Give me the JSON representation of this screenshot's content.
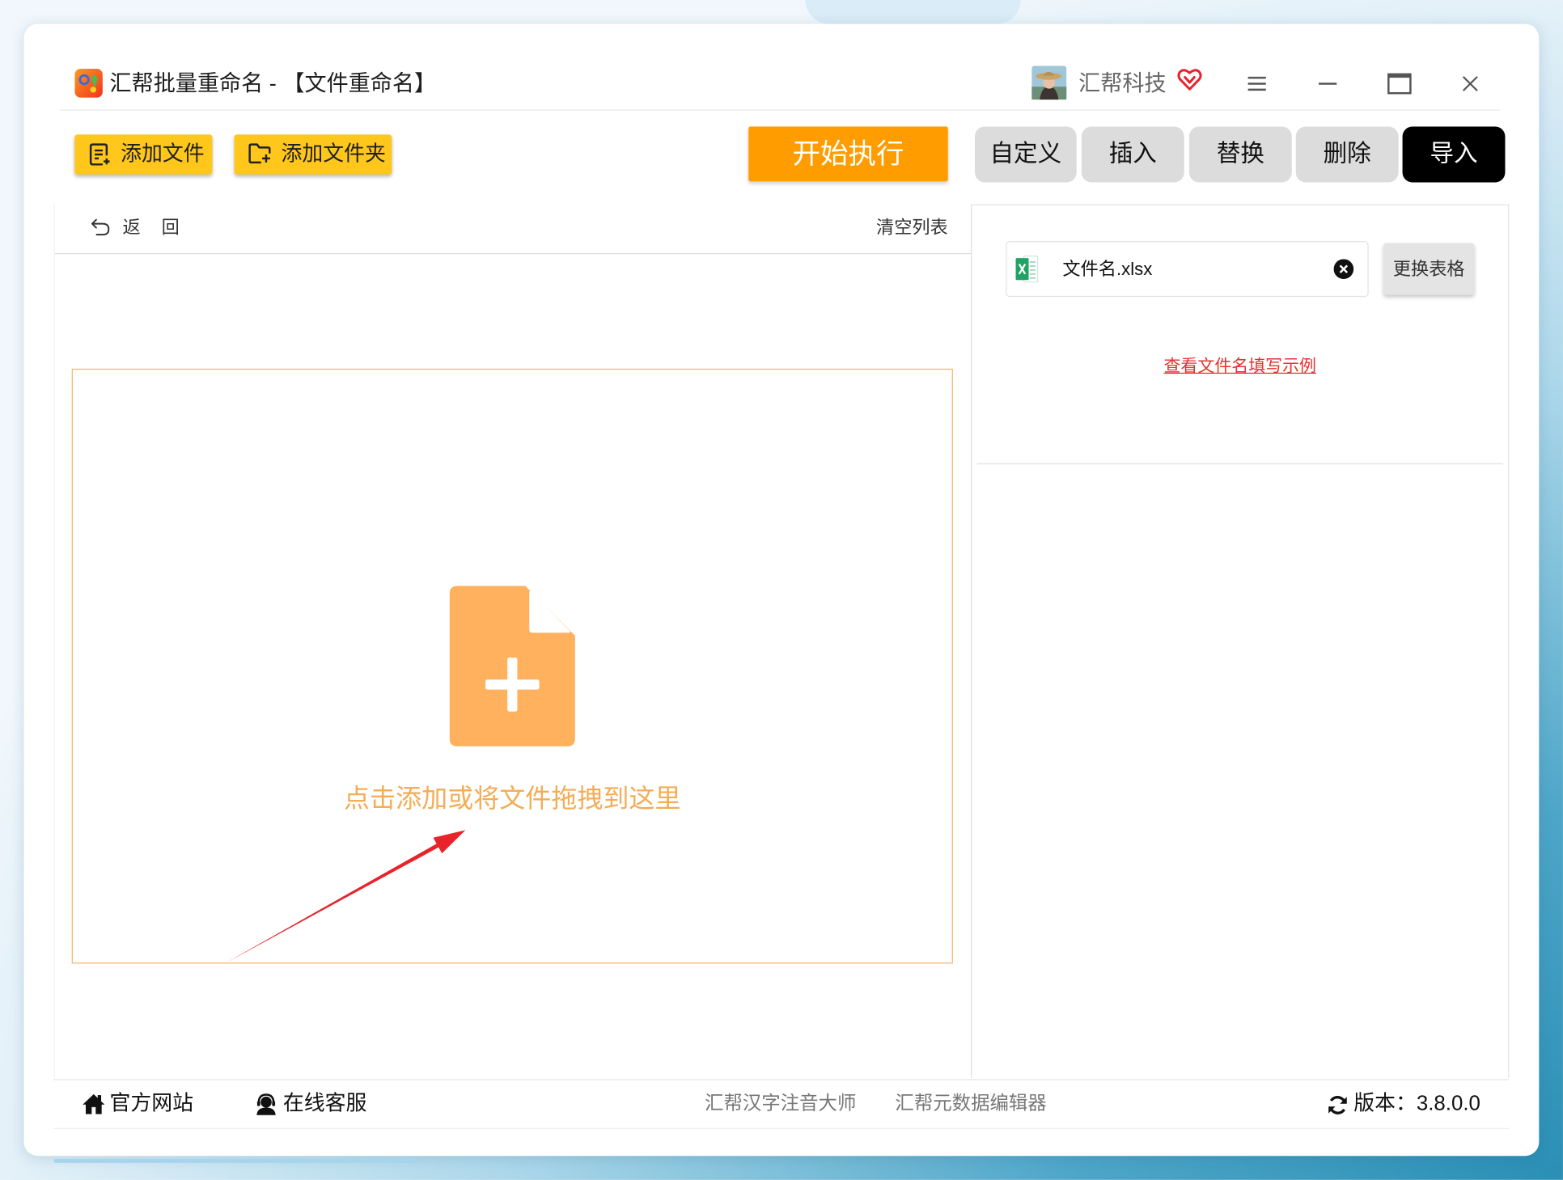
{
  "window": {
    "title": "汇帮批量重命名 - 【文件重命名】",
    "user_name": "汇帮科技"
  },
  "toolbar": {
    "add_file_label": "添加文件",
    "add_folder_label": "添加文件夹",
    "start_label": "开始执行",
    "tabs": [
      {
        "label": "自定义",
        "active": false
      },
      {
        "label": "插入",
        "active": false
      },
      {
        "label": "替换",
        "active": false
      },
      {
        "label": "删除",
        "active": false
      },
      {
        "label": "导入",
        "active": true
      }
    ]
  },
  "file_list": {
    "back_label": "返 回",
    "clear_label": "清空列表",
    "drop_hint": "点击添加或将文件拖拽到这里"
  },
  "import_panel": {
    "file_name": "文件名.xlsx",
    "replace_label": "更换表格",
    "example_link": "查看文件名填写示例"
  },
  "footer": {
    "website_label": "官方网站",
    "support_label": "在线客服",
    "links": [
      "汇帮汉字注音大师",
      "汇帮元数据编辑器"
    ],
    "version_label": "版本：",
    "version": "3.8.0.0"
  },
  "colors": {
    "accent_yellow": "#FFC61C",
    "start_orange": "#FF9C00",
    "drop_orange": "#FFB15E",
    "link_red": "#E5322D",
    "active_tab": "#000000"
  },
  "icons": {
    "logo": "app-logo-icon",
    "vip": "vip-heart-icon",
    "menu": "menu-icon",
    "minimize": "minimize-icon",
    "maximize": "maximize-icon",
    "close": "close-icon",
    "add_file": "add-document-icon",
    "add_folder": "add-folder-icon",
    "back": "undo-arrow-icon",
    "drop": "file-add-icon",
    "spreadsheet": "excel-file-icon",
    "remove": "close-circle-icon",
    "website": "home-icon",
    "support": "headset-user-icon",
    "update": "refresh-icon"
  }
}
